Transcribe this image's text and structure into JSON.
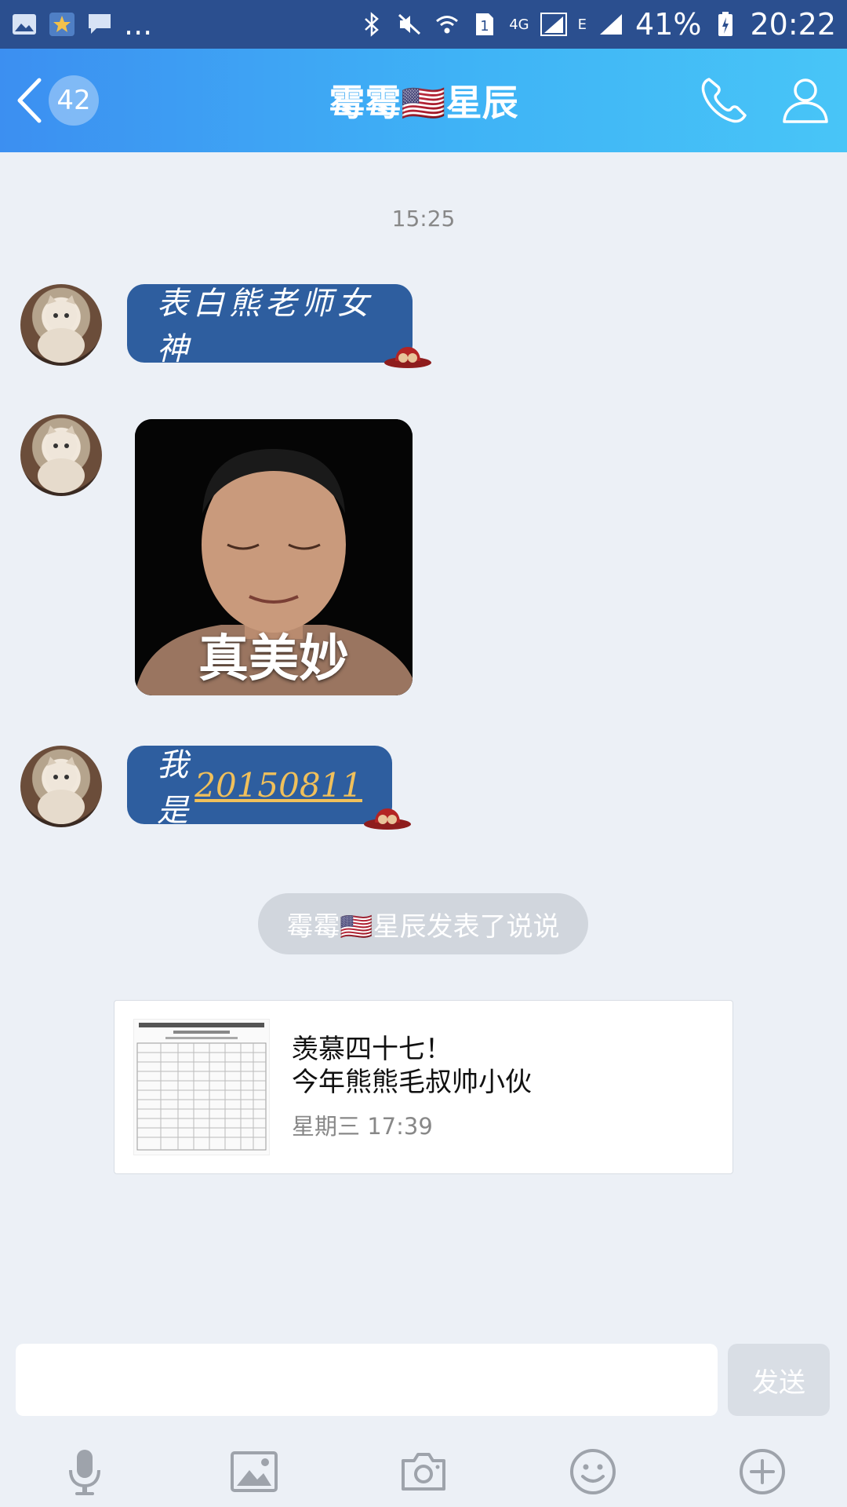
{
  "status_bar": {
    "left_icons": [
      "gallery-icon",
      "star-icon",
      "chat-icon"
    ],
    "more": "...",
    "right_icons": [
      "bluetooth-icon",
      "mute-icon",
      "wifi-icon",
      "sim1-icon"
    ],
    "network_4g": "4G",
    "network_e": "E",
    "battery": "41%",
    "time": "20:22"
  },
  "header": {
    "unread_count": "42",
    "contact_name": "霉霉🇺🇸星辰",
    "call_icon": "phone-icon",
    "profile_icon": "person-icon"
  },
  "chat": {
    "timestamp": "15:25",
    "messages": [
      {
        "text": "表白熊老师女神"
      },
      {
        "caption": "真美妙"
      },
      {
        "prefix": "我是",
        "link": "20150811"
      }
    ],
    "system_notice": "霉霉🇺🇸星辰发表了说说",
    "shared_post": {
      "title_line1": "羡慕四十七！",
      "title_line2": "今年熊熊毛叔帅小伙",
      "time": "星期三 17:39"
    }
  },
  "input": {
    "value": "",
    "send_label": "发送"
  },
  "toolbar": {
    "icons": [
      "microphone-icon",
      "image-icon",
      "camera-icon",
      "emoji-icon",
      "plus-icon"
    ]
  },
  "colors": {
    "header_start": "#3c8ff1",
    "header_end": "#48c5f7",
    "bubble": "#2e5e9f",
    "link": "#f0c05b",
    "background": "#ecf0f6"
  }
}
